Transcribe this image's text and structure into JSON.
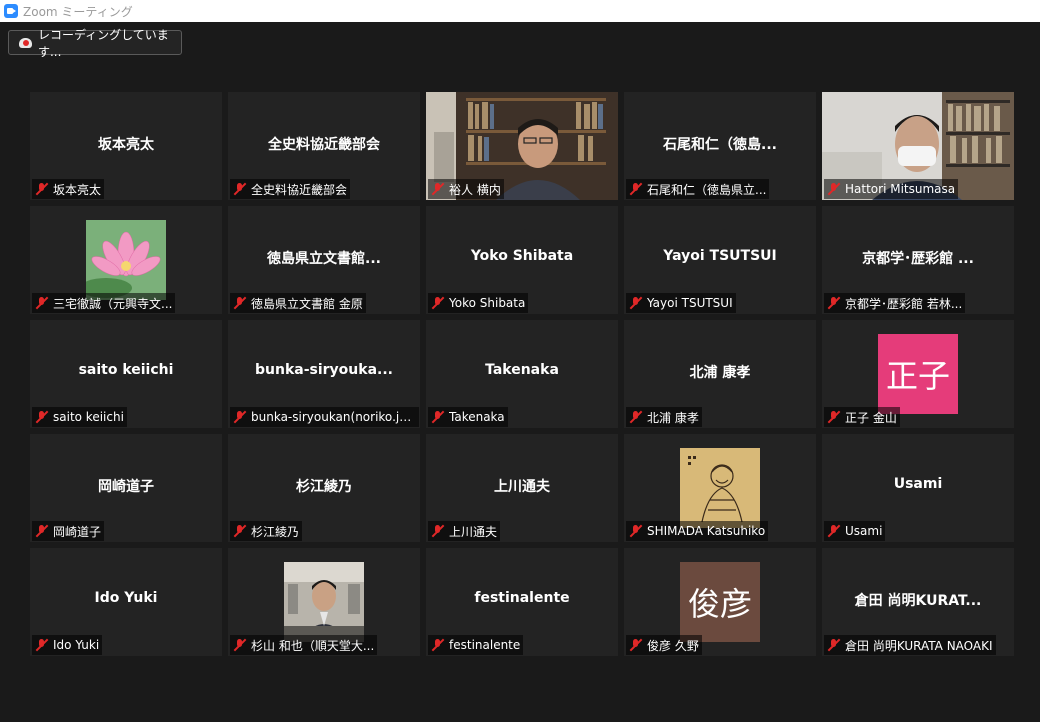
{
  "window": {
    "title": "Zoom ミーティング"
  },
  "recording": {
    "label": "レコーディングしています..."
  },
  "colors": {
    "active_border": "#d6ee3a",
    "mute": "#e02828",
    "avatar_masako": "#e53c7a",
    "avatar_toshihiko": "#6b4a3e"
  },
  "tiles": [
    {
      "center": "坂本亮太",
      "label": "坂本亮太",
      "type": "name"
    },
    {
      "center": "全史料協近畿部会",
      "label": "全史料協近畿部会",
      "type": "name"
    },
    {
      "center": "",
      "label": "裕人 横内",
      "type": "video-bookshelf",
      "active": true
    },
    {
      "center": "石尾和仁（徳島...",
      "label": "石尾和仁（徳島県立...",
      "type": "name"
    },
    {
      "center": "",
      "label": "Hattori Mitsumasa",
      "type": "video-office"
    },
    {
      "center": "",
      "label": "三宅徹誠（元興寺文...",
      "type": "pic-lotus"
    },
    {
      "center": "徳島県立文書館...",
      "label": "徳島県立文書館 金原",
      "type": "name"
    },
    {
      "center": "Yoko Shibata",
      "label": "Yoko Shibata",
      "type": "name"
    },
    {
      "center": "Yayoi TSUTSUI",
      "label": "Yayoi TSUTSUI",
      "type": "name"
    },
    {
      "center": "京都学･歴彩館 ...",
      "label": "京都学･歴彩館 若林...",
      "type": "name"
    },
    {
      "center": "saito keiichi",
      "label": "saito keiichi",
      "type": "name"
    },
    {
      "center": "bunka-siryouka...",
      "label": "bunka-siryoukan(noriko.jok...",
      "type": "name"
    },
    {
      "center": "Takenaka",
      "label": "Takenaka",
      "type": "name"
    },
    {
      "center": "北浦 康孝",
      "label": "北浦 康孝",
      "type": "name"
    },
    {
      "center": "",
      "label": "正子 金山",
      "type": "avatar",
      "avatar_text": "正子",
      "avatar_color": "#e53c7a"
    },
    {
      "center": "岡崎道子",
      "label": "岡崎道子",
      "type": "name"
    },
    {
      "center": "杉江綾乃",
      "label": "杉江綾乃",
      "type": "name"
    },
    {
      "center": "上川通夫",
      "label": "上川通夫",
      "type": "name"
    },
    {
      "center": "",
      "label": "SHIMADA Katsuhiko",
      "type": "pic-scroll"
    },
    {
      "center": "Usami",
      "label": "Usami",
      "type": "name"
    },
    {
      "center": "Ido Yuki",
      "label": "Ido Yuki",
      "type": "name"
    },
    {
      "center": "",
      "label": "杉山 和也（順天堂大...",
      "type": "pic-man"
    },
    {
      "center": "festinalente",
      "label": "festinalente",
      "type": "name"
    },
    {
      "center": "",
      "label": "俊彦 久野",
      "type": "avatar",
      "avatar_text": "俊彦",
      "avatar_color": "#6b4a3e"
    },
    {
      "center": "倉田 尚明KURAT...",
      "label": "倉田 尚明KURATA NAOAKI",
      "type": "name"
    }
  ]
}
